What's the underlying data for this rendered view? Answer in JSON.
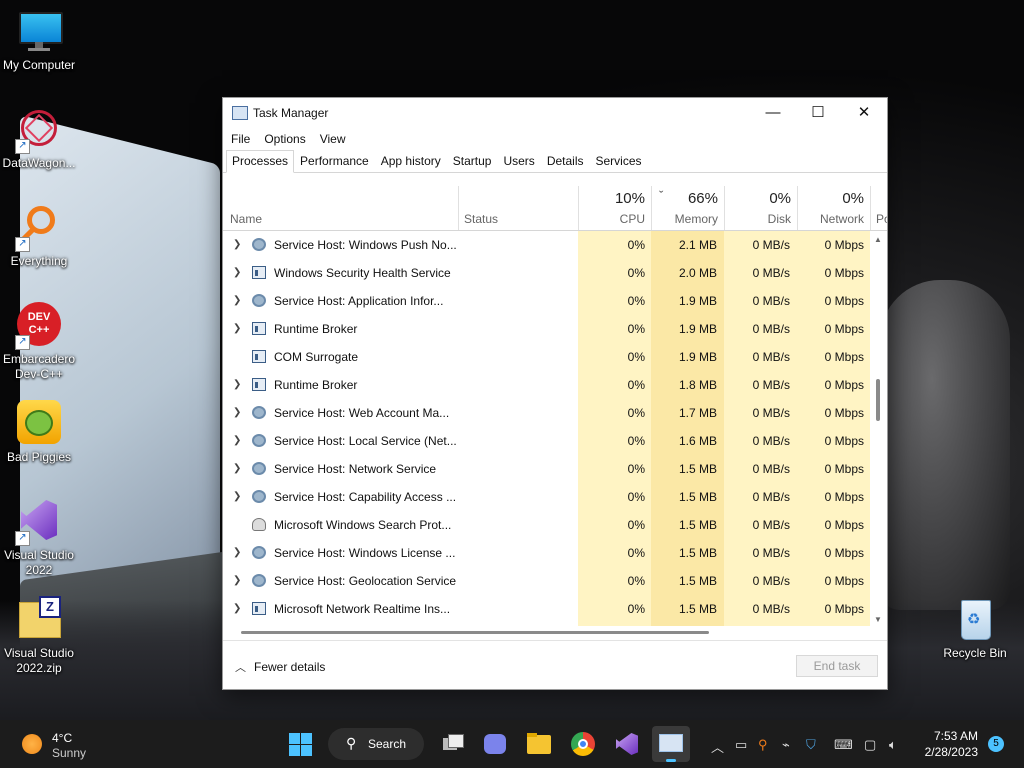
{
  "desktop": {
    "icons": [
      {
        "label": "My Computer",
        "icon": "monitor-icon"
      },
      {
        "label": "DataWagon...",
        "icon": "datawagon-icon"
      },
      {
        "label": "Everything",
        "icon": "magnifier-icon"
      },
      {
        "label": "Embarcadero Dev-C++",
        "icon": "devcpp-icon",
        "badge": "DEV C++"
      },
      {
        "label": "Bad Piggies",
        "icon": "bad-piggies-icon"
      },
      {
        "label": "Visual Studio 2022",
        "icon": "visual-studio-icon"
      },
      {
        "label": "Visual Studio 2022.zip",
        "icon": "zip-folder-icon"
      },
      {
        "label": "Recycle Bin",
        "icon": "recycle-bin-icon"
      }
    ]
  },
  "window": {
    "title": "Task Manager",
    "controls": {
      "minimize": "—",
      "maximize": "☐",
      "close": "✕"
    },
    "menu": [
      "File",
      "Options",
      "View"
    ],
    "tabs": [
      "Processes",
      "Performance",
      "App history",
      "Startup",
      "Users",
      "Details",
      "Services"
    ],
    "active_tab": "Processes",
    "columns": {
      "name": {
        "label": "Name"
      },
      "status": {
        "label": "Status"
      },
      "cpu": {
        "pct": "10%",
        "label": "CPU"
      },
      "memory": {
        "pct": "66%",
        "label": "Memory",
        "sort_indicator": "ˇ"
      },
      "disk": {
        "pct": "0%",
        "label": "Disk"
      },
      "network": {
        "pct": "0%",
        "label": "Network"
      },
      "power": {
        "label": "Po"
      }
    },
    "rows": [
      {
        "name": "Service Host: Windows Push No...",
        "icon": "gear",
        "expand": true,
        "cpu": "0%",
        "mem": "2.1 MB",
        "disk": "0 MB/s",
        "net": "0 Mbps"
      },
      {
        "name": "Windows Security Health Service",
        "icon": "win",
        "expand": true,
        "cpu": "0%",
        "mem": "2.0 MB",
        "disk": "0 MB/s",
        "net": "0 Mbps"
      },
      {
        "name": "Service Host: Application Infor...",
        "icon": "gear",
        "expand": true,
        "cpu": "0%",
        "mem": "1.9 MB",
        "disk": "0 MB/s",
        "net": "0 Mbps"
      },
      {
        "name": "Runtime Broker",
        "icon": "win",
        "expand": true,
        "cpu": "0%",
        "mem": "1.9 MB",
        "disk": "0 MB/s",
        "net": "0 Mbps"
      },
      {
        "name": "COM Surrogate",
        "icon": "win",
        "expand": false,
        "cpu": "0%",
        "mem": "1.9 MB",
        "disk": "0 MB/s",
        "net": "0 Mbps"
      },
      {
        "name": "Runtime Broker",
        "icon": "win",
        "expand": true,
        "cpu": "0%",
        "mem": "1.8 MB",
        "disk": "0 MB/s",
        "net": "0 Mbps"
      },
      {
        "name": "Service Host: Web Account Ma...",
        "icon": "gear",
        "expand": true,
        "cpu": "0%",
        "mem": "1.7 MB",
        "disk": "0 MB/s",
        "net": "0 Mbps"
      },
      {
        "name": "Service Host: Local Service (Net...",
        "icon": "gear",
        "expand": true,
        "cpu": "0%",
        "mem": "1.6 MB",
        "disk": "0 MB/s",
        "net": "0 Mbps"
      },
      {
        "name": "Service Host: Network Service",
        "icon": "gear",
        "expand": true,
        "cpu": "0%",
        "mem": "1.5 MB",
        "disk": "0 MB/s",
        "net": "0 Mbps"
      },
      {
        "name": "Service Host: Capability Access ...",
        "icon": "gear",
        "expand": true,
        "cpu": "0%",
        "mem": "1.5 MB",
        "disk": "0 MB/s",
        "net": "0 Mbps"
      },
      {
        "name": "Microsoft Windows Search Prot...",
        "icon": "person",
        "expand": false,
        "cpu": "0%",
        "mem": "1.5 MB",
        "disk": "0 MB/s",
        "net": "0 Mbps"
      },
      {
        "name": "Service Host: Windows License ...",
        "icon": "gear",
        "expand": true,
        "cpu": "0%",
        "mem": "1.5 MB",
        "disk": "0 MB/s",
        "net": "0 Mbps"
      },
      {
        "name": "Service Host: Geolocation Service",
        "icon": "gear",
        "expand": true,
        "cpu": "0%",
        "mem": "1.5 MB",
        "disk": "0 MB/s",
        "net": "0 Mbps"
      },
      {
        "name": "Microsoft Network Realtime Ins...",
        "icon": "win",
        "expand": true,
        "cpu": "0%",
        "mem": "1.5 MB",
        "disk": "0 MB/s",
        "net": "0 Mbps"
      }
    ],
    "footer": {
      "fewer_details": "Fewer details",
      "end_task": "End task"
    }
  },
  "taskbar": {
    "weather": {
      "temp": "4°C",
      "condition": "Sunny"
    },
    "search_label": "Search",
    "clock": {
      "time": "7:53 AM",
      "date": "2/28/2023"
    },
    "notification_count": "5",
    "apps": [
      "start-icon",
      "task-view-icon",
      "chat-icon",
      "file-explorer-icon",
      "chrome-icon",
      "visual-studio-icon",
      "task-manager-icon"
    ],
    "tray": [
      "chevron-up-icon",
      "tablet-icon",
      "search-everything-icon",
      "network-off-icon",
      "defender-icon",
      "keyboard-icon",
      "display-icon",
      "volume-icon"
    ]
  },
  "colors": {
    "heat_light": "#fff4c4",
    "heat_mid": "#fbe8a6",
    "taskbar": "#1c1c1c"
  }
}
